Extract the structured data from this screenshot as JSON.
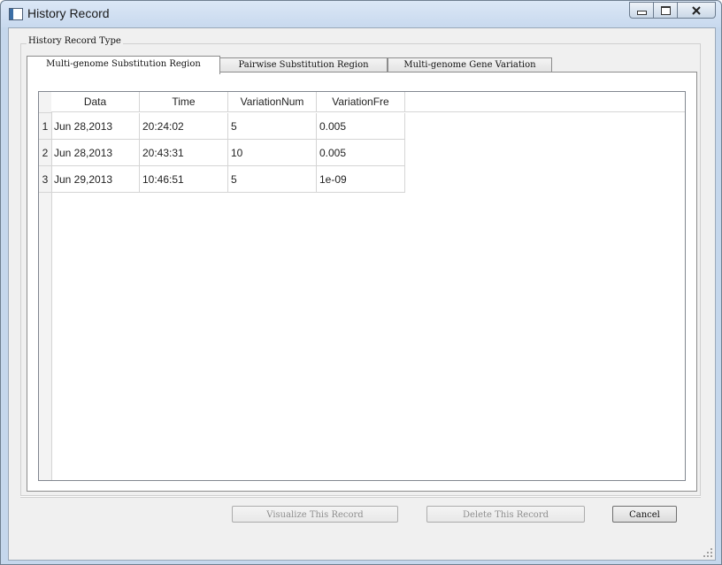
{
  "window": {
    "title": "History Record",
    "controls": [
      "minimize-icon",
      "maximize-icon",
      "close-icon"
    ]
  },
  "group": {
    "label": "History Record Type"
  },
  "tabs": [
    {
      "label": "Multi-genome Substitution Region",
      "active": true
    },
    {
      "label": "Pairwise Substitution Region",
      "active": false
    },
    {
      "label": "Multi-genome Gene Variation",
      "active": false
    }
  ],
  "table": {
    "columns": [
      "Data",
      "Time",
      "VariationNum",
      "VariationFre"
    ],
    "rows": [
      {
        "num": "1",
        "cells": [
          "Jun 28,2013",
          "20:24:02",
          "5",
          "0.005"
        ]
      },
      {
        "num": "2",
        "cells": [
          "Jun 28,2013",
          "20:43:31",
          "10",
          "0.005"
        ]
      },
      {
        "num": "3",
        "cells": [
          "Jun 29,2013",
          "10:46:51",
          "5",
          "1e-09"
        ]
      }
    ]
  },
  "buttons": {
    "visualize": {
      "label": "Visualize This Record",
      "enabled": false
    },
    "delete": {
      "label": "Delete This Record",
      "enabled": false
    },
    "cancel": {
      "label": "Cancel",
      "enabled": true
    }
  }
}
